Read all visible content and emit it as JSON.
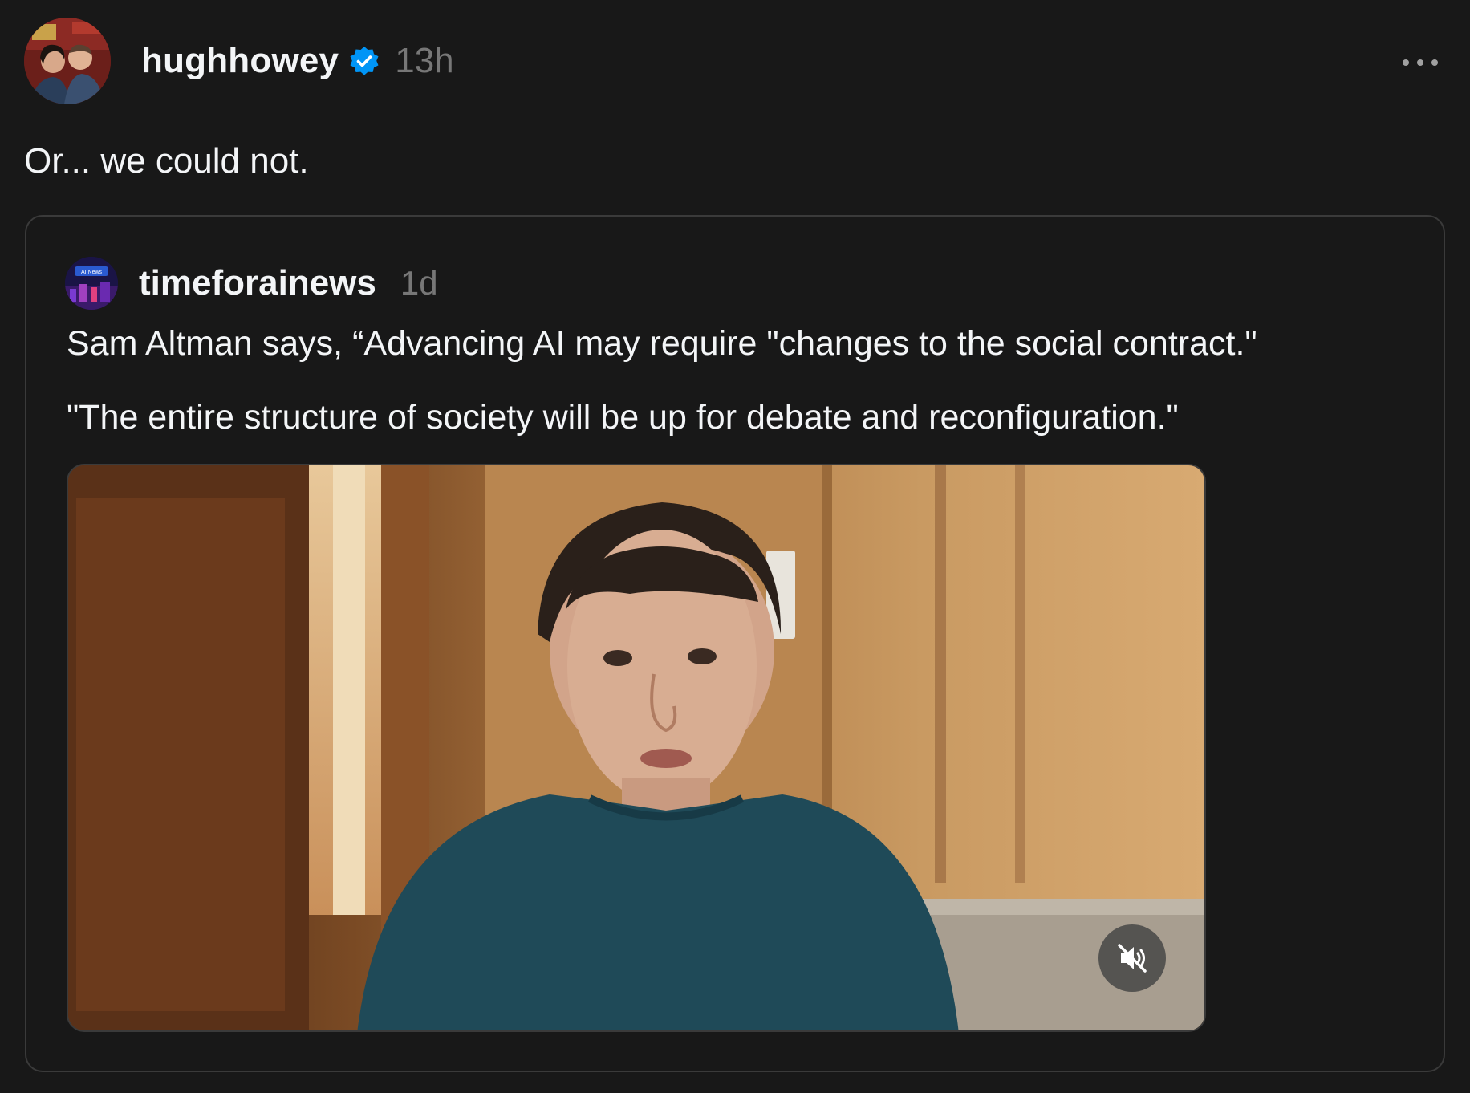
{
  "post": {
    "author": {
      "username": "hughhowey",
      "verified": true,
      "avatar_icon": "profile-photo",
      "timestamp": "13h"
    },
    "more_icon": "more-options-icon",
    "caption": "Or... we could not."
  },
  "quoted_post": {
    "author": {
      "username": "timeforainews",
      "avatar_icon": "ai-news-logo",
      "avatar_logo_text": "AI News",
      "timestamp": "1d"
    },
    "text_lines": [
      "Sam Altman says, “Advancing AI may require \"changes to the social contract.\"",
      "\"The entire structure of society will be up for debate and reconfiguration.\""
    ],
    "media": {
      "type": "video",
      "muted": true,
      "mute_icon": "speaker-muted-icon"
    }
  },
  "colors": {
    "background": "#181818",
    "text_primary": "#f3f5f7",
    "text_secondary": "#777777",
    "border": "#3a3a3a",
    "verified_blue": "#0095f6"
  }
}
